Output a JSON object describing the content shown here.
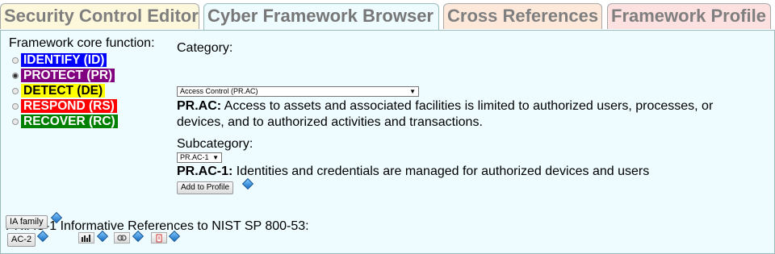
{
  "tabs": [
    {
      "label": "Security Control Editor"
    },
    {
      "label": "Cyber Framework Browser"
    },
    {
      "label": "Cross References"
    },
    {
      "label": "Framework Profile"
    }
  ],
  "core": {
    "label": "Framework core function:",
    "selected": "PROTECT (PR)",
    "functions": [
      {
        "label": "IDENTIFY (ID)",
        "bg": "#0000ff",
        "fg": "#ffffff"
      },
      {
        "label": "PROTECT (PR)",
        "bg": "#800080",
        "fg": "#ffffff"
      },
      {
        "label": "DETECT (DE)",
        "bg": "#ffff00",
        "fg": "#000000"
      },
      {
        "label": "RESPOND (RS)",
        "bg": "#ff0000",
        "fg": "#ffffff"
      },
      {
        "label": "RECOVER (RC)",
        "bg": "#008000",
        "fg": "#ffffff"
      }
    ]
  },
  "category": {
    "label": "Category:",
    "selected": "Access Control (PR.AC)",
    "code": "PR.AC:",
    "text": "Access to assets and associated facilities is limited to authorized users, processes, or devices, and to authorized activities and transactions."
  },
  "subcategory": {
    "label": "Subcategory:",
    "selected": "PR.AC-1",
    "code": "PR.AC-1:",
    "text": "Identities and credentials are managed for authorized devices and users",
    "add_button": "Add to Profile"
  },
  "references": {
    "title": "PR.AC-1 Informative References to NIST SP 800-53:",
    "family_button": "IA family",
    "control_button": "AC-2"
  }
}
